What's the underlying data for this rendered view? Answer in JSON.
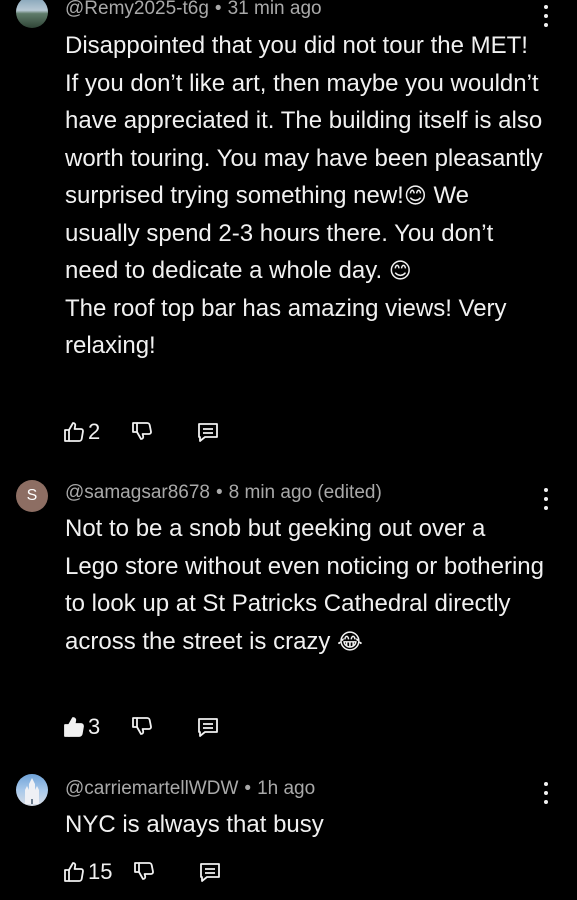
{
  "comments": [
    {
      "author": "@Remy2025-t6g",
      "separator": "•",
      "time": "31 min ago",
      "body": [
        "Disappointed that you did not tour the MET! If you don’t like art, then maybe you wouldn’t have appreciated it. The building itself is also worth touring. You may have been pleasantly surprised trying something new!",
        "We usually spend 2-3 hours there. You don’t need to dedicate a whole day.",
        "The roof top bar has amazing views! Very relaxing!"
      ],
      "emoji": [
        "😊",
        "😊"
      ],
      "likes": "2"
    },
    {
      "avatar_letter": "S",
      "author": "@samagsar8678",
      "separator": "•",
      "time": "8 min ago (edited)",
      "body": [
        "Not to be a snob but geeking out over a Lego store without even noticing or bothering to look up at St Patricks Cathedral directly across the street is crazy"
      ],
      "emoji": [
        "😂"
      ],
      "likes": "3"
    },
    {
      "author": "@carriemartellWDW",
      "separator": "•",
      "time": "1h ago",
      "body": [
        "NYC is always that busy"
      ],
      "likes": "15"
    }
  ],
  "icons": {
    "like": "thumbs-up-icon",
    "dislike": "thumbs-down-icon",
    "reply": "reply-icon",
    "more": "more-vertical-icon"
  },
  "colors": {
    "background": "#000000",
    "text": "#f1f1f1",
    "meta": "#a9a9a9",
    "avatar_s": "#8d6e63"
  }
}
